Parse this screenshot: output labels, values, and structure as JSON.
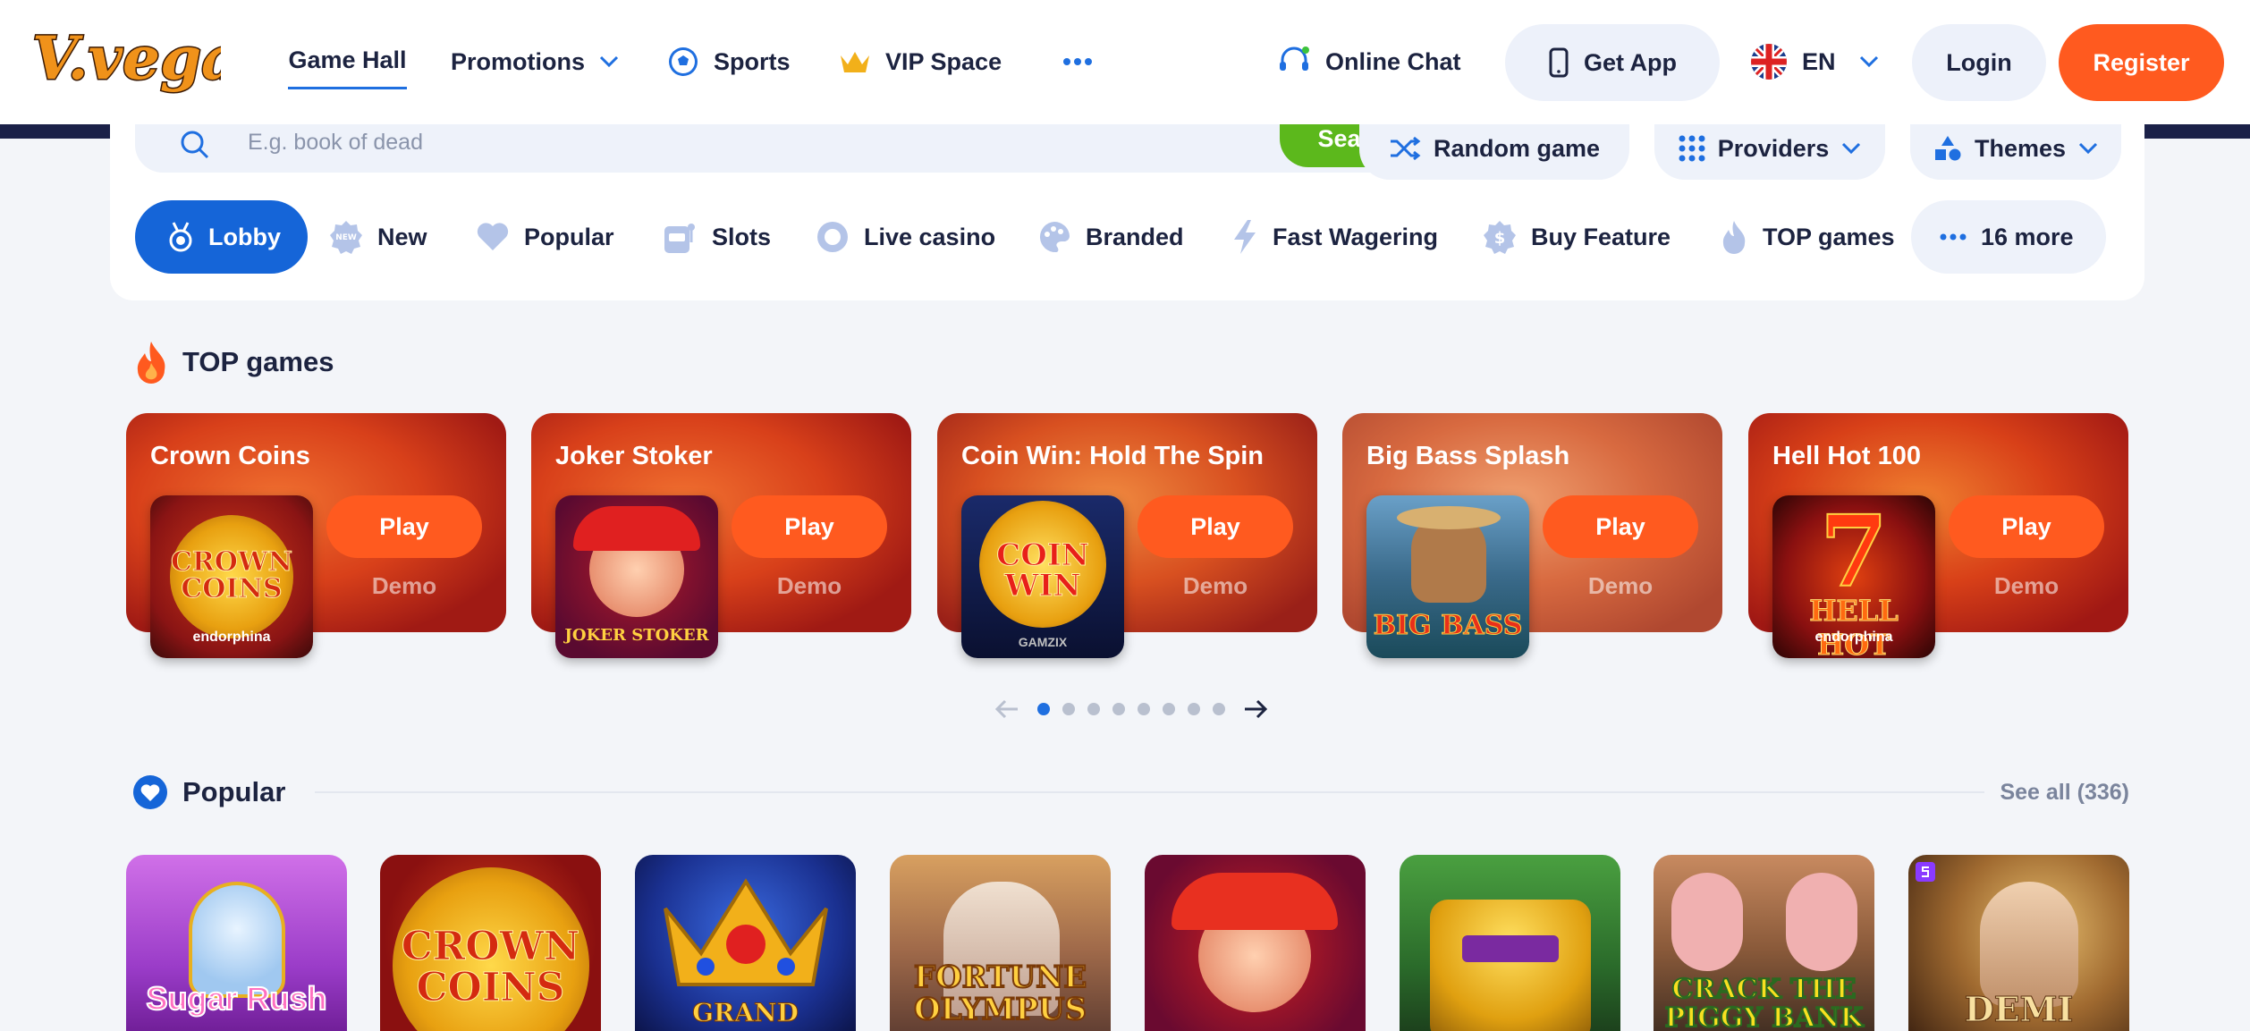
{
  "header": {
    "logo_text": "V.vegas",
    "nav": [
      {
        "label": "Game Hall"
      },
      {
        "label": "Promotions"
      },
      {
        "label": "Sports"
      },
      {
        "label": "VIP Space"
      }
    ],
    "online_chat": "Online Chat",
    "get_app": "Get App",
    "language": "EN",
    "login": "Login",
    "register": "Register"
  },
  "search": {
    "placeholder": "E.g. book of dead",
    "button": "Search",
    "random_game": "Random game",
    "providers": "Providers",
    "themes": "Themes"
  },
  "categories": [
    {
      "label": "Lobby",
      "icon": "medal-icon"
    },
    {
      "label": "New",
      "icon": "new-badge-icon"
    },
    {
      "label": "Popular",
      "icon": "heart-icon"
    },
    {
      "label": "Slots",
      "icon": "slot-machine-icon"
    },
    {
      "label": "Live casino",
      "icon": "live-icon"
    },
    {
      "label": "Branded",
      "icon": "palette-icon"
    },
    {
      "label": "Fast Wagering",
      "icon": "lightning-icon"
    },
    {
      "label": "Buy Feature",
      "icon": "dollar-coin-icon"
    },
    {
      "label": "TOP games",
      "icon": "flame-icon"
    },
    {
      "label": "16 more",
      "icon": "dots-icon"
    }
  ],
  "top_games": {
    "title": "TOP games",
    "cards": [
      {
        "title": "Crown Coins",
        "play": "Play",
        "demo": "Demo",
        "thumb_text": "CROWN COINS",
        "provider": "endorphina"
      },
      {
        "title": "Joker Stoker",
        "play": "Play",
        "demo": "Demo",
        "thumb_text": "JOKER STOKER",
        "provider": ""
      },
      {
        "title": "Coin Win: Hold The Spin",
        "play": "Play",
        "demo": "Demo",
        "thumb_text": "COIN WIN",
        "provider": "GAMZIX"
      },
      {
        "title": "Big Bass Splash",
        "play": "Play",
        "demo": "Demo",
        "thumb_text": "BIG BASS",
        "provider": ""
      },
      {
        "title": "Hell Hot 100",
        "play": "Play",
        "demo": "Demo",
        "thumb_text": "HELL HOT",
        "provider": "endorphina"
      }
    ],
    "carousel_pages": 8,
    "carousel_active": 1
  },
  "popular": {
    "title": "Popular",
    "see_all": "See all (336)",
    "games": [
      {
        "thumb_text": "Sugar Rush",
        "colors": [
          "#c55de0",
          "#7a2ca8"
        ]
      },
      {
        "thumb_text": "CROWN COINS",
        "colors": [
          "#e0501e",
          "#8a1010"
        ]
      },
      {
        "thumb_text": "GRAND CROWN",
        "colors": [
          "#2250b8",
          "#0d1a55"
        ]
      },
      {
        "thumb_text": "FORTUNE OLYMPUS",
        "colors": [
          "#e8a060",
          "#6a3a30"
        ]
      },
      {
        "thumb_text": "",
        "colors": [
          "#d02020",
          "#4a0a30"
        ]
      },
      {
        "thumb_text": "",
        "colors": [
          "#3a9a30",
          "#1a4a20"
        ]
      },
      {
        "thumb_text": "CRACK THE PIGGY BANK",
        "colors": [
          "#8a5a3a",
          "#3a2a20"
        ]
      },
      {
        "thumb_text": "DEMI GODS",
        "colors": [
          "#d0a050",
          "#3a2010"
        ]
      }
    ]
  },
  "colors": {
    "accent": "#ff5a1f",
    "primary": "#1565d8",
    "search": "#5cb81c",
    "dark": "#1b2148"
  }
}
